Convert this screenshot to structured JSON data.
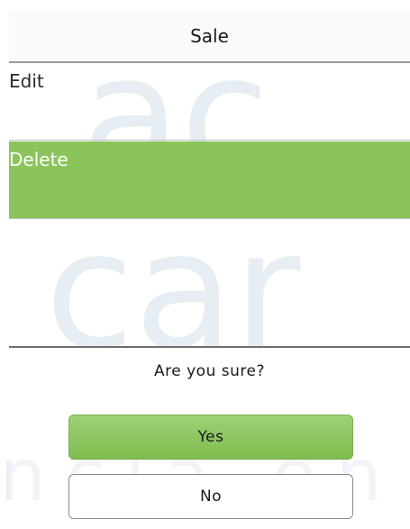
{
  "header": {
    "title": "Sale"
  },
  "menu": {
    "items": [
      {
        "label": "Edit"
      },
      {
        "label": "Delete"
      }
    ]
  },
  "dialog": {
    "prompt": "Are you sure?",
    "yes_label": "Yes",
    "no_label": "No"
  },
  "colors": {
    "selected": "#8ac45a",
    "yes_button": "#8cc660"
  }
}
